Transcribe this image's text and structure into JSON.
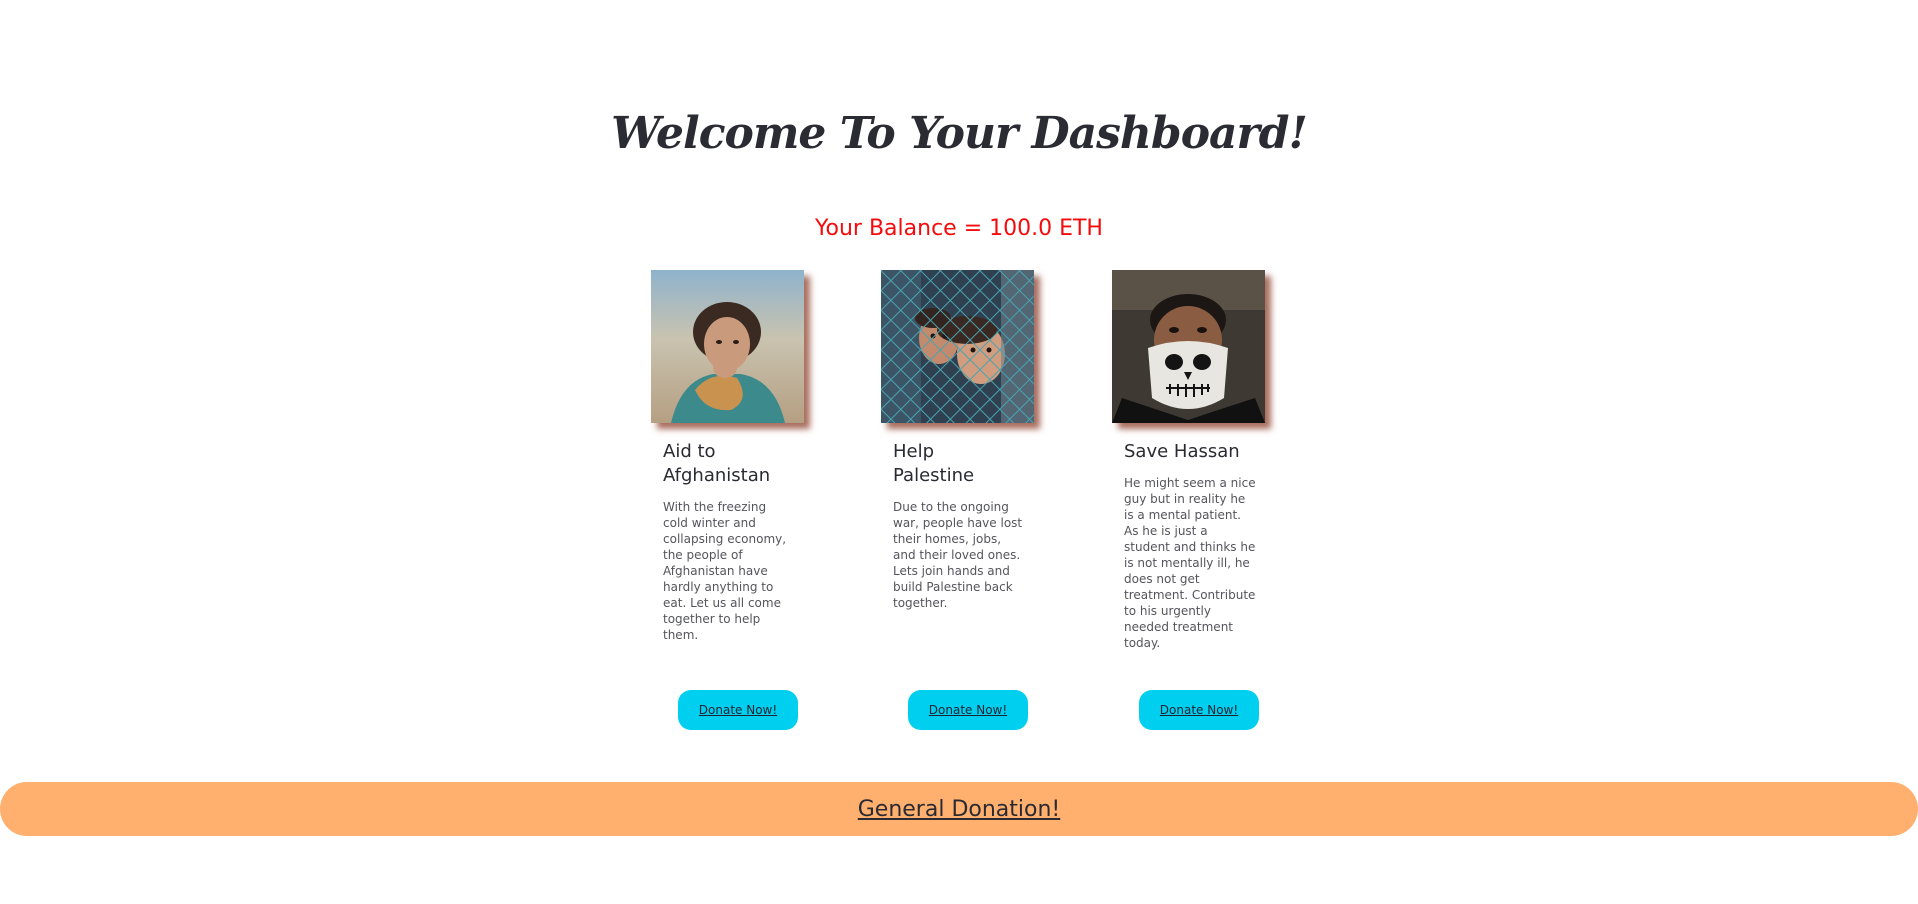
{
  "header": {
    "title": "Welcome To Your Dashboard!",
    "balance": "Your Balance = 100.0 ETH"
  },
  "causes": [
    {
      "title": "Aid to Afghanistan",
      "description": "With the freezing cold winter and collapsing economy, the people of Afghanistan have hardly anything to eat. Let us all come together to help them.",
      "button_label": "Donate Now!",
      "image_icon": "child-photo"
    },
    {
      "title": "Help Palestine",
      "description": "Due to the ongoing war, people have lost their homes, jobs, and their loved ones. Lets join hands and build Palestine back together.",
      "button_label": "Donate Now!",
      "image_icon": "children-behind-fence-photo"
    },
    {
      "title": "Save Hassan",
      "description": "He might seem a nice guy but in reality he is a mental patient. As he is just a student and thinks he is not mentally ill, he does not get treatment. Contribute to his urgently needed treatment today.",
      "button_label": "Donate Now!",
      "image_icon": "masked-man-photo"
    }
  ],
  "general": {
    "label": "General Donation!"
  },
  "colors": {
    "balance": "#f40c0c",
    "donate_button": "#00cff0",
    "general_bar": "#ffb06e",
    "photo_shadow": "#8c3c28"
  }
}
